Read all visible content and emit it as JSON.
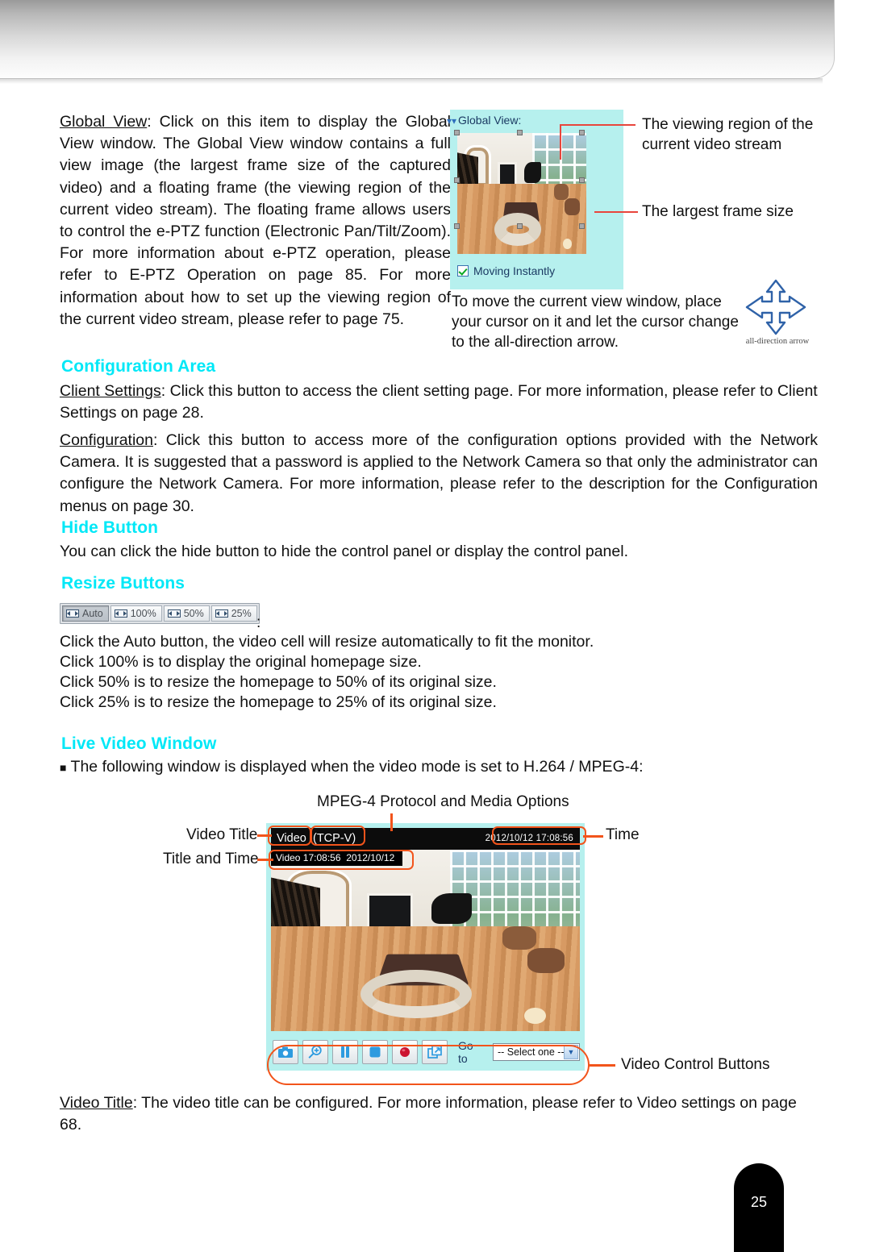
{
  "document": {
    "page_number": "25"
  },
  "global_view_section": {
    "paragraph": "Global View: Click on this item to display the Global View window. The Global View window contains a full view image (the largest frame size of the captured video) and a floating frame (the viewing region of the current video stream). The floating frame allows users to control the e-PTZ function (Electronic Pan/Tilt/Zoom). For more information about e-PTZ operation, please refer to E-PTZ Operation on page 85. For more information about how to set up the viewing region of the current video stream, please refer to page 75.",
    "term": "Global View",
    "screenshot": {
      "panel_title": "Global View:",
      "checkbox_label": "Moving Instantly",
      "checkbox_checked": true,
      "panel_bg": "#b6f0ee"
    },
    "callouts": {
      "viewing_region": "The viewing region of the current video stream",
      "largest_frame": "The largest frame size",
      "move_note": "To move the current view window, place your cursor on it and let the cursor change to the all-direction arrow.",
      "arrow_caption": "all-direction arrow"
    }
  },
  "configuration_area": {
    "heading": "Configuration Area",
    "client_settings_term": "Client Settings",
    "client_settings_text": ": Click this button to access the client setting page. For more information, please refer to Client Settings on page 28.",
    "configuration_term": "Configuration",
    "configuration_text": ": Click this button to access more of the configuration options provided with the Network Camera. It is suggested that a password is applied to the Network Camera so that only the administrator can configure the Network Camera. For more information, please refer to the description for the Configuration menus on page 30."
  },
  "hide_button": {
    "heading": "Hide Button",
    "text": "You can click the hide button to hide the control panel or display the control panel."
  },
  "resize_buttons": {
    "heading": "Resize Buttons",
    "buttons": [
      {
        "label": "Auto",
        "active": true
      },
      {
        "label": "100%",
        "active": false
      },
      {
        "label": "50%",
        "active": false
      },
      {
        "label": "25%",
        "active": false
      }
    ],
    "colon": ":",
    "lines": [
      "Click the Auto button, the video cell will resize automatically to fit the monitor.",
      "Click 100% is to display the original homepage size.",
      "Click 50% is to resize the homepage to 50% of its original size.",
      "Click 25% is to resize the homepage to 25% of its original size."
    ]
  },
  "live_video_window": {
    "heading": "Live Video Window",
    "bullet": "The following window is displayed when the video mode is set to H.264 / MPEG-4:",
    "diagram": {
      "label_protocol": "MPEG-4 Protocol and Media Options",
      "label_video_title": "Video Title",
      "label_title_and_time": "Title and Time",
      "label_time": "Time",
      "label_video_controls": "Video Control Buttons",
      "player": {
        "title": "Video",
        "protocol": "(TCP-V)",
        "time": "2012/10/12 17:08:56",
        "osd": "Video 17:08:56  2012/10/12",
        "goto_label": "Go to",
        "goto_value": "-- Select one --",
        "controls": [
          {
            "name": "snapshot",
            "icon": "camera-icon"
          },
          {
            "name": "digital-zoom",
            "icon": "magnifier-plus-icon"
          },
          {
            "name": "pause",
            "icon": "pause-icon"
          },
          {
            "name": "stop",
            "icon": "stop-icon"
          },
          {
            "name": "record",
            "icon": "record-icon"
          },
          {
            "name": "full-screen",
            "icon": "expand-icon"
          }
        ]
      }
    },
    "video_title_term": "Video Title",
    "video_title_text": ": The video title can be configured. For more information, please refer to Video settings on page 68."
  },
  "colors": {
    "heading_cyan": "#00e8f7",
    "callout_orange": "#f2541b",
    "callout_red": "#e8453c",
    "panel_cyan": "#b6f0ee"
  }
}
